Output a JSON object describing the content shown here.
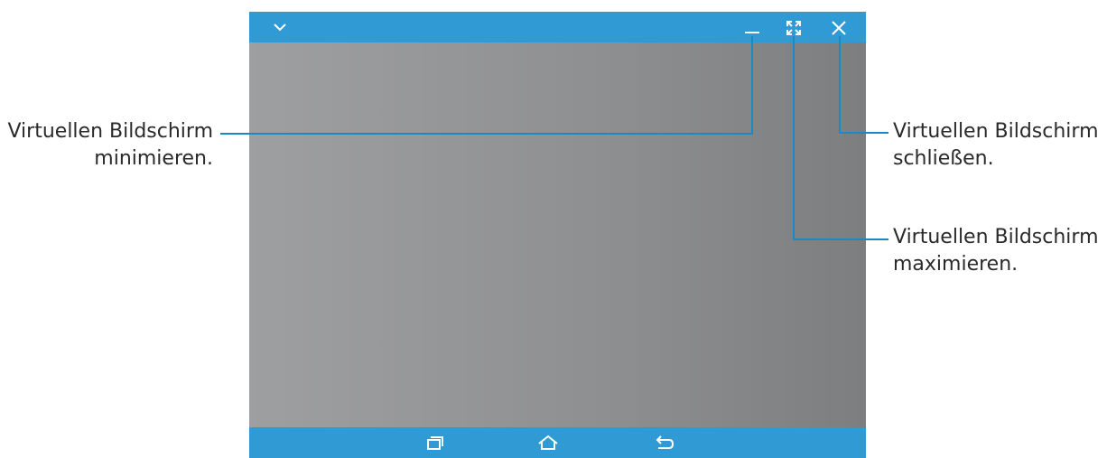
{
  "window": {
    "collapse_icon": "chevron-down-icon",
    "minimize_icon": "minimize-icon",
    "maximize_icon": "maximize-icon",
    "close_icon": "close-icon"
  },
  "navbar": {
    "recent_icon": "recent-apps-icon",
    "home_icon": "home-icon",
    "back_icon": "back-icon"
  },
  "callouts": {
    "minimize": {
      "line1": "Virtuellen Bildschirm",
      "line2": "minimieren."
    },
    "close": {
      "line1": "Virtuellen Bildschirm",
      "line2": "schließen."
    },
    "maximize": {
      "line1": "Virtuellen Bildschirm",
      "line2": "maximieren."
    }
  },
  "colors": {
    "bar_blue": "#2f9ad3",
    "callout_line": "#1a8ac6",
    "screen_gray_light": "#9e9fa1",
    "screen_gray_dark": "#7d7e80"
  }
}
